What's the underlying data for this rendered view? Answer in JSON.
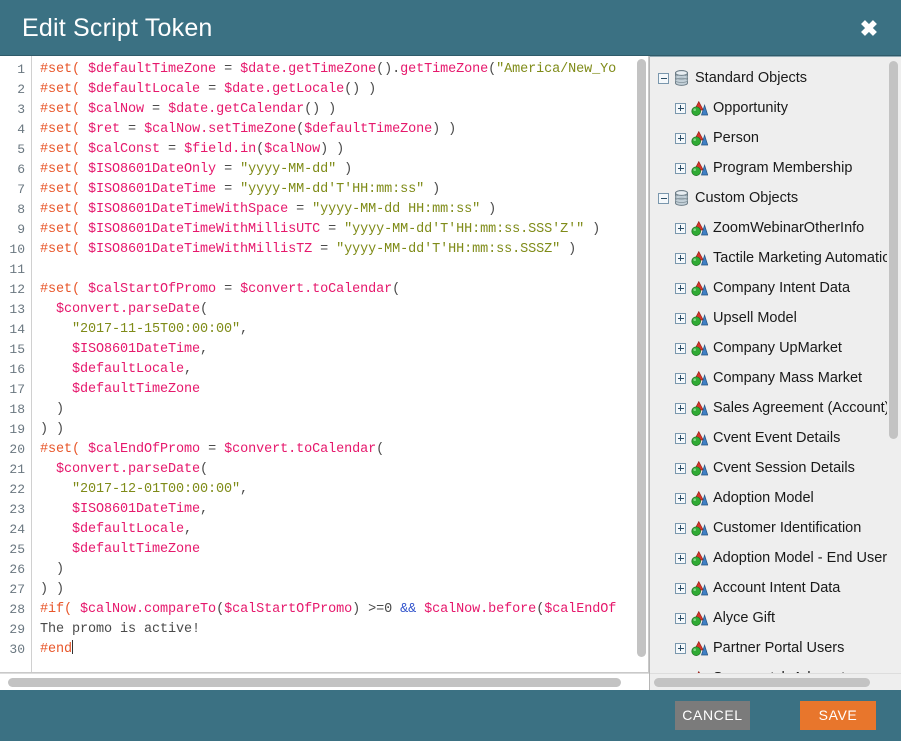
{
  "header": {
    "title": "Edit Script Token",
    "close_label": "✖",
    "close_icon": "close-icon"
  },
  "editor": {
    "lines": [
      {
        "n": 1,
        "tokens": [
          {
            "t": "#set(",
            "c": "dir"
          },
          {
            "t": " ",
            "c": "pln"
          },
          {
            "t": "$defaultTimeZone",
            "c": "var"
          },
          {
            "t": " = ",
            "c": "pln"
          },
          {
            "t": "$date.getTimeZone",
            "c": "var"
          },
          {
            "t": "().",
            "c": "pln"
          },
          {
            "t": "getTimeZone",
            "c": "var"
          },
          {
            "t": "(",
            "c": "pln"
          },
          {
            "t": "\"America/New_Yo",
            "c": "str"
          }
        ]
      },
      {
        "n": 2,
        "tokens": [
          {
            "t": "#set(",
            "c": "dir"
          },
          {
            "t": " ",
            "c": "pln"
          },
          {
            "t": "$defaultLocale",
            "c": "var"
          },
          {
            "t": " = ",
            "c": "pln"
          },
          {
            "t": "$date.getLocale",
            "c": "var"
          },
          {
            "t": "() )",
            "c": "pln"
          }
        ]
      },
      {
        "n": 3,
        "tokens": [
          {
            "t": "#set(",
            "c": "dir"
          },
          {
            "t": " ",
            "c": "pln"
          },
          {
            "t": "$calNow",
            "c": "var"
          },
          {
            "t": " = ",
            "c": "pln"
          },
          {
            "t": "$date.getCalendar",
            "c": "var"
          },
          {
            "t": "() )",
            "c": "pln"
          }
        ]
      },
      {
        "n": 4,
        "tokens": [
          {
            "t": "#set(",
            "c": "dir"
          },
          {
            "t": " ",
            "c": "pln"
          },
          {
            "t": "$ret",
            "c": "var"
          },
          {
            "t": " = ",
            "c": "pln"
          },
          {
            "t": "$calNow.setTimeZone",
            "c": "var"
          },
          {
            "t": "(",
            "c": "pln"
          },
          {
            "t": "$defaultTimeZone",
            "c": "var"
          },
          {
            "t": ") )",
            "c": "pln"
          }
        ]
      },
      {
        "n": 5,
        "tokens": [
          {
            "t": "#set(",
            "c": "dir"
          },
          {
            "t": " ",
            "c": "pln"
          },
          {
            "t": "$calConst",
            "c": "var"
          },
          {
            "t": " = ",
            "c": "pln"
          },
          {
            "t": "$field.in",
            "c": "var"
          },
          {
            "t": "(",
            "c": "pln"
          },
          {
            "t": "$calNow",
            "c": "var"
          },
          {
            "t": ") )",
            "c": "pln"
          }
        ]
      },
      {
        "n": 6,
        "tokens": [
          {
            "t": "#set(",
            "c": "dir"
          },
          {
            "t": " ",
            "c": "pln"
          },
          {
            "t": "$ISO8601DateOnly",
            "c": "var"
          },
          {
            "t": " = ",
            "c": "pln"
          },
          {
            "t": "\"yyyy-MM-dd\"",
            "c": "str"
          },
          {
            "t": " )",
            "c": "pln"
          }
        ]
      },
      {
        "n": 7,
        "tokens": [
          {
            "t": "#set(",
            "c": "dir"
          },
          {
            "t": " ",
            "c": "pln"
          },
          {
            "t": "$ISO8601DateTime",
            "c": "var"
          },
          {
            "t": " = ",
            "c": "pln"
          },
          {
            "t": "\"yyyy-MM-dd'T'HH:mm:ss\"",
            "c": "str"
          },
          {
            "t": " )",
            "c": "pln"
          }
        ]
      },
      {
        "n": 8,
        "tokens": [
          {
            "t": "#set(",
            "c": "dir"
          },
          {
            "t": " ",
            "c": "pln"
          },
          {
            "t": "$ISO8601DateTimeWithSpace",
            "c": "var"
          },
          {
            "t": " = ",
            "c": "pln"
          },
          {
            "t": "\"yyyy-MM-dd HH:mm:ss\"",
            "c": "str"
          },
          {
            "t": " )",
            "c": "pln"
          }
        ]
      },
      {
        "n": 9,
        "tokens": [
          {
            "t": "#set(",
            "c": "dir"
          },
          {
            "t": " ",
            "c": "pln"
          },
          {
            "t": "$ISO8601DateTimeWithMillisUTC",
            "c": "var"
          },
          {
            "t": " = ",
            "c": "pln"
          },
          {
            "t": "\"yyyy-MM-dd'T'HH:mm:ss.SSS'Z'\"",
            "c": "str"
          },
          {
            "t": " )",
            "c": "pln"
          }
        ]
      },
      {
        "n": 10,
        "tokens": [
          {
            "t": "#set(",
            "c": "dir"
          },
          {
            "t": " ",
            "c": "pln"
          },
          {
            "t": "$ISO8601DateTimeWithMillisTZ",
            "c": "var"
          },
          {
            "t": " = ",
            "c": "pln"
          },
          {
            "t": "\"yyyy-MM-dd'T'HH:mm:ss.SSSZ\"",
            "c": "str"
          },
          {
            "t": " )",
            "c": "pln"
          }
        ]
      },
      {
        "n": 11,
        "tokens": []
      },
      {
        "n": 12,
        "tokens": [
          {
            "t": "#set(",
            "c": "dir"
          },
          {
            "t": " ",
            "c": "pln"
          },
          {
            "t": "$calStartOfPromo",
            "c": "var"
          },
          {
            "t": " = ",
            "c": "pln"
          },
          {
            "t": "$convert.toCalendar",
            "c": "var"
          },
          {
            "t": "(",
            "c": "pln"
          }
        ]
      },
      {
        "n": 13,
        "tokens": [
          {
            "t": "  ",
            "c": "pln"
          },
          {
            "t": "$convert.parseDate",
            "c": "var"
          },
          {
            "t": "(",
            "c": "pln"
          }
        ]
      },
      {
        "n": 14,
        "tokens": [
          {
            "t": "    ",
            "c": "pln"
          },
          {
            "t": "\"2017-11-15T00:00:00\"",
            "c": "str"
          },
          {
            "t": ",",
            "c": "pln"
          }
        ]
      },
      {
        "n": 15,
        "tokens": [
          {
            "t": "    ",
            "c": "pln"
          },
          {
            "t": "$ISO8601DateTime",
            "c": "var"
          },
          {
            "t": ",",
            "c": "pln"
          }
        ]
      },
      {
        "n": 16,
        "tokens": [
          {
            "t": "    ",
            "c": "pln"
          },
          {
            "t": "$defaultLocale",
            "c": "var"
          },
          {
            "t": ",",
            "c": "pln"
          }
        ]
      },
      {
        "n": 17,
        "tokens": [
          {
            "t": "    ",
            "c": "pln"
          },
          {
            "t": "$defaultTimeZone",
            "c": "var"
          }
        ]
      },
      {
        "n": 18,
        "tokens": [
          {
            "t": "  )",
            "c": "pln"
          }
        ]
      },
      {
        "n": 19,
        "tokens": [
          {
            "t": ") )",
            "c": "pln"
          }
        ]
      },
      {
        "n": 20,
        "tokens": [
          {
            "t": "#set(",
            "c": "dir"
          },
          {
            "t": " ",
            "c": "pln"
          },
          {
            "t": "$calEndOfPromo",
            "c": "var"
          },
          {
            "t": " = ",
            "c": "pln"
          },
          {
            "t": "$convert.toCalendar",
            "c": "var"
          },
          {
            "t": "(",
            "c": "pln"
          }
        ]
      },
      {
        "n": 21,
        "tokens": [
          {
            "t": "  ",
            "c": "pln"
          },
          {
            "t": "$convert.parseDate",
            "c": "var"
          },
          {
            "t": "(",
            "c": "pln"
          }
        ]
      },
      {
        "n": 22,
        "tokens": [
          {
            "t": "    ",
            "c": "pln"
          },
          {
            "t": "\"2017-12-01T00:00:00\"",
            "c": "str"
          },
          {
            "t": ",",
            "c": "pln"
          }
        ]
      },
      {
        "n": 23,
        "tokens": [
          {
            "t": "    ",
            "c": "pln"
          },
          {
            "t": "$ISO8601DateTime",
            "c": "var"
          },
          {
            "t": ",",
            "c": "pln"
          }
        ]
      },
      {
        "n": 24,
        "tokens": [
          {
            "t": "    ",
            "c": "pln"
          },
          {
            "t": "$defaultLocale",
            "c": "var"
          },
          {
            "t": ",",
            "c": "pln"
          }
        ]
      },
      {
        "n": 25,
        "tokens": [
          {
            "t": "    ",
            "c": "pln"
          },
          {
            "t": "$defaultTimeZone",
            "c": "var"
          }
        ]
      },
      {
        "n": 26,
        "tokens": [
          {
            "t": "  )",
            "c": "pln"
          }
        ]
      },
      {
        "n": 27,
        "tokens": [
          {
            "t": ") )",
            "c": "pln"
          }
        ]
      },
      {
        "n": 28,
        "tokens": [
          {
            "t": "#if(",
            "c": "dir"
          },
          {
            "t": " ",
            "c": "pln"
          },
          {
            "t": "$calNow.compareTo",
            "c": "var"
          },
          {
            "t": "(",
            "c": "pln"
          },
          {
            "t": "$calStartOfPromo",
            "c": "var"
          },
          {
            "t": ") >=0 ",
            "c": "pln"
          },
          {
            "t": "&&",
            "c": "op"
          },
          {
            "t": " ",
            "c": "pln"
          },
          {
            "t": "$calNow.before",
            "c": "var"
          },
          {
            "t": "(",
            "c": "pln"
          },
          {
            "t": "$calEndOf",
            "c": "var"
          }
        ]
      },
      {
        "n": 29,
        "tokens": [
          {
            "t": "The promo is active!",
            "c": "pln"
          }
        ]
      },
      {
        "n": 30,
        "tokens": [
          {
            "t": "#end",
            "c": "dir"
          }
        ],
        "caret": true
      }
    ]
  },
  "tree": {
    "nodes": [
      {
        "label": "Standard Objects",
        "level": "root",
        "icon": "database-icon",
        "expander": "minus"
      },
      {
        "label": "Opportunity",
        "level": "child",
        "icon": "object-shapes-icon",
        "expander": "plus"
      },
      {
        "label": "Person",
        "level": "child",
        "icon": "object-shapes-icon",
        "expander": "plus"
      },
      {
        "label": "Program Membership",
        "level": "child",
        "icon": "object-shapes-icon",
        "expander": "plus"
      },
      {
        "label": "Custom Objects",
        "level": "root",
        "icon": "database-icon",
        "expander": "minus"
      },
      {
        "label": "ZoomWebinarOtherInfo",
        "level": "child",
        "icon": "object-shapes-icon",
        "expander": "plus"
      },
      {
        "label": "Tactile Marketing Automation",
        "level": "child",
        "icon": "object-shapes-icon",
        "expander": "plus"
      },
      {
        "label": "Company Intent Data",
        "level": "child",
        "icon": "object-shapes-icon",
        "expander": "plus"
      },
      {
        "label": "Upsell Model",
        "level": "child",
        "icon": "object-shapes-icon",
        "expander": "plus"
      },
      {
        "label": "Company UpMarket",
        "level": "child",
        "icon": "object-shapes-icon",
        "expander": "plus"
      },
      {
        "label": "Company Mass Market",
        "level": "child",
        "icon": "object-shapes-icon",
        "expander": "plus"
      },
      {
        "label": "Sales Agreement (Account)",
        "level": "child",
        "icon": "object-shapes-icon",
        "expander": "plus"
      },
      {
        "label": "Cvent Event Details",
        "level": "child",
        "icon": "object-shapes-icon",
        "expander": "plus"
      },
      {
        "label": "Cvent Session Details",
        "level": "child",
        "icon": "object-shapes-icon",
        "expander": "plus"
      },
      {
        "label": "Adoption Model",
        "level": "child",
        "icon": "object-shapes-icon",
        "expander": "plus"
      },
      {
        "label": "Customer Identification",
        "level": "child",
        "icon": "object-shapes-icon",
        "expander": "plus"
      },
      {
        "label": "Adoption Model - End User",
        "level": "child",
        "icon": "object-shapes-icon",
        "expander": "plus"
      },
      {
        "label": "Account Intent Data",
        "level": "child",
        "icon": "object-shapes-icon",
        "expander": "plus"
      },
      {
        "label": "Alyce Gift",
        "level": "child",
        "icon": "object-shapes-icon",
        "expander": "plus"
      },
      {
        "label": "Partner Portal Users",
        "level": "child",
        "icon": "object-shapes-icon",
        "expander": "plus"
      },
      {
        "label": "Saasquatch Advocate",
        "level": "child",
        "icon": "object-shapes-icon",
        "expander": "plus"
      }
    ]
  },
  "footer": {
    "cancel_label": "CANCEL",
    "save_label": "SAVE"
  },
  "colors": {
    "chrome": "#3b7183",
    "save": "#e8762c",
    "cancel": "#7b7b7b",
    "directive": "#e8562a",
    "variable": "#e6186c",
    "string": "#7f8b18",
    "operator": "#3355cc"
  }
}
